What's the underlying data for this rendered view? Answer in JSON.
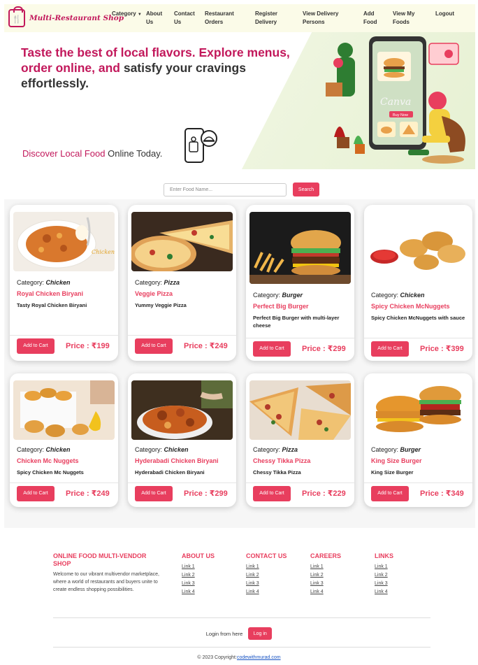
{
  "brand": {
    "name": "Multi-Restaurant Shop",
    "icon": "shopping-bag-icon"
  },
  "nav": [
    {
      "label": "Category",
      "has_caret": true
    },
    {
      "label": "About Us"
    },
    {
      "label": "Contact Us"
    },
    {
      "label": "Restaurant Orders"
    },
    {
      "label": "Register Delivery"
    },
    {
      "label": "View Delivery Persons"
    },
    {
      "label": "Add Food"
    },
    {
      "label": "View My Foods"
    },
    {
      "label": "Logout"
    }
  ],
  "hero": {
    "title_pink": "Taste the best of local flavors. Explore menus, order online, and",
    "title_dark": "satisfy your cravings effortlessly.",
    "sub_pink": "Discover Local Food",
    "sub_dark": "Online Today.",
    "illustration_sign": "Canva",
    "illustration_button": "Buy Now"
  },
  "search": {
    "placeholder": "Enter Food Name...",
    "button": "Search"
  },
  "category_prefix": "Category:",
  "cart_label": "Add to Cart",
  "price_prefix": "Price : ",
  "foods": [
    {
      "category": "Chicken",
      "name": "Royal Chicken Biryani",
      "desc": "Tasty Royal Chicken Biryani",
      "price": "₹199",
      "img_text": "Chicken Biryani"
    },
    {
      "category": "Pizza",
      "name": "Veggie Pizza",
      "desc": "Yummy Veggie Pizza",
      "price": "₹249"
    },
    {
      "category": "Burger",
      "name": "Perfect Big Burger",
      "desc": "Perfect Big Burger with multi-layer cheese",
      "price": "₹299"
    },
    {
      "category": "Chicken",
      "name": "Spicy Chicken McNuggets",
      "desc": "Spicy Chicken McNuggets with sauce",
      "price": "₹399"
    },
    {
      "category": "Chicken",
      "name": "Chicken Mc Nuggets",
      "desc": "Spicy Chicken Mc Nuggets",
      "price": "₹249"
    },
    {
      "category": "Chicken",
      "name": "Hyderabadi Chicken Biryani",
      "desc": "Hyderabadi Chicken Biryani",
      "price": "₹299"
    },
    {
      "category": "Pizza",
      "name": "Chessy Tikka Pizza",
      "desc": "Chessy Tikka Pizza",
      "price": "₹229"
    },
    {
      "category": "Burger",
      "name": "King Size Burger",
      "desc": "King Size Burger",
      "price": "₹349"
    }
  ],
  "footer": {
    "about_title": "ONLINE FOOD MULTI-VENDOR SHOP",
    "about_text": "Welcome to our vibrant multivendor marketplace, where a world of restaurants and buyers unite to create endless shopping possibilities.",
    "columns": [
      {
        "title": "ABOUT US",
        "links": [
          "Link 1",
          "Link 2",
          "Link 3",
          "Link 4"
        ]
      },
      {
        "title": "CONTACT US",
        "links": [
          "Link 1",
          "Link 2",
          "Link 3",
          "Link 4"
        ]
      },
      {
        "title": "CAREERS",
        "links": [
          "Link 1",
          "Link 2",
          "Link 3",
          "Link 4"
        ]
      },
      {
        "title": "LINKS",
        "links": [
          "Link 1",
          "Link 2",
          "Link 3",
          "Link 4"
        ]
      }
    ],
    "login_text": "Login from here",
    "login_button": "Log in",
    "copyright_text": "© 2023 Copyright:",
    "copyright_link": "codewithmurad.com"
  },
  "colors": {
    "accent": "#e83e5e",
    "brand": "#c2185b",
    "nav_bg": "#fbfbe8"
  }
}
